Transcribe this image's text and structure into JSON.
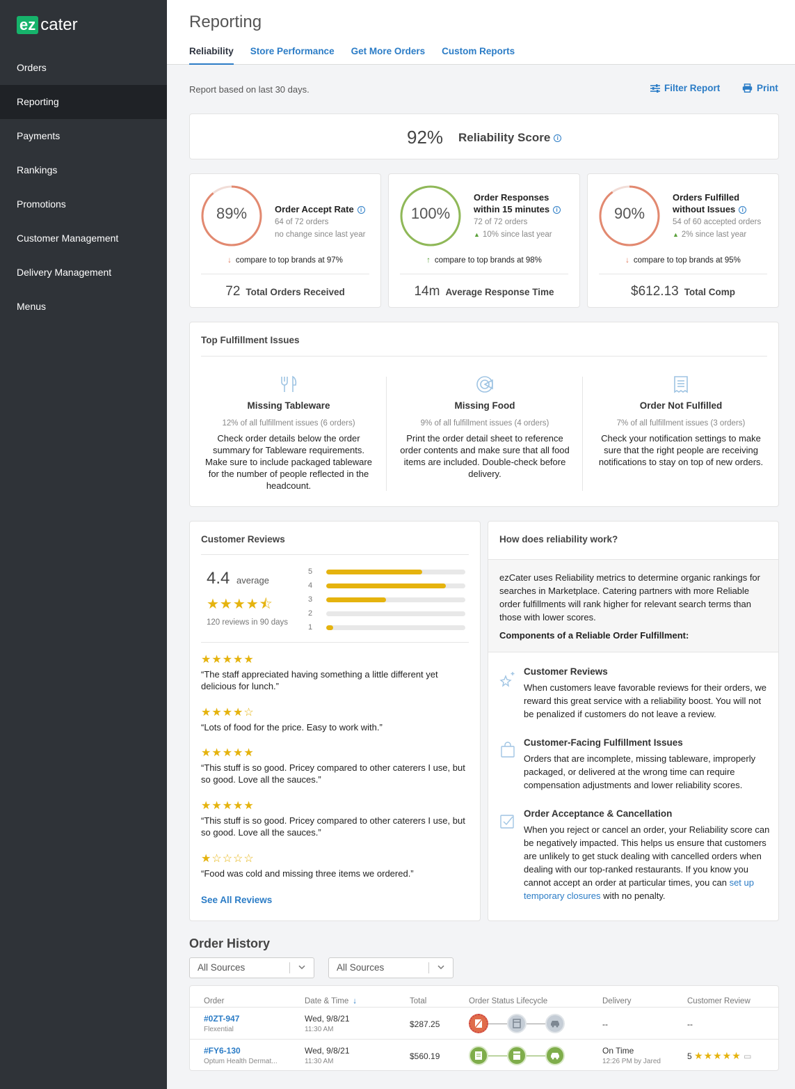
{
  "app": {
    "logo_ez": "ez",
    "logo_cater": "cater"
  },
  "nav": [
    "Orders",
    "Reporting",
    "Payments",
    "Rankings",
    "Promotions",
    "Customer Management",
    "Delivery Management",
    "Menus"
  ],
  "page": {
    "title": "Reporting",
    "tabs": [
      "Reliability",
      "Store Performance",
      "Get More Orders",
      "Custom Reports"
    ],
    "subhead": "Report based on last 30 days.",
    "filter_label": "Filter Report",
    "print_label": "Print"
  },
  "score": {
    "value": "92%",
    "label": "Reliability Score"
  },
  "metrics": [
    {
      "percent": "89%",
      "title": "Order Accept Rate",
      "sub": "64 of 72 orders",
      "trend": "no change since last year",
      "compare": "compare to top brands at 97%",
      "foot_value": "72",
      "foot_label": "Total Orders Received",
      "fraction": 0.89,
      "color": "#e28970"
    },
    {
      "percent": "100%",
      "title_line1": "Order Responses",
      "title_line2": "within 15 minutes",
      "sub": "72 of 72 orders",
      "trend": "10% since last year",
      "compare": "compare to top brands at 98%",
      "foot_value": "14m",
      "foot_label": "Average Response Time",
      "fraction": 1.0,
      "color": "#8fb858"
    },
    {
      "percent": "90%",
      "title_line1": "Orders Fulfilled",
      "title_line2": "without Issues",
      "sub": "54 of 60 accepted orders",
      "trend": "2% since last year",
      "compare": "compare to top brands at 95%",
      "foot_value": "$612.13",
      "foot_label": "Total Comp",
      "fraction": 0.9,
      "color": "#e28970"
    }
  ],
  "issues": {
    "title": "Top Fulfillment Issues",
    "items": [
      {
        "icon": "utensils-icon",
        "title": "Missing Tableware",
        "sub": "12% of all fulfillment issues (6 orders)",
        "desc": "Check order details below the order summary for Tableware requirements. Make sure to include packaged tableware for the number of people reflected in the headcount."
      },
      {
        "icon": "food-plate-icon",
        "title": "Missing Food",
        "sub": "9% of all fulfillment issues (4 orders)",
        "desc": "Print the order detail sheet to reference order contents and make sure that all food items are included. Double-check before delivery."
      },
      {
        "icon": "receipt-icon",
        "title": "Order Not Fulfilled",
        "sub": "7% of all fulfillment issues (3 orders)",
        "desc": "Check your notification settings to make sure that the right people are receiving notifications to stay on top of new orders."
      }
    ]
  },
  "reviews": {
    "title": "Customer Reviews",
    "average": "4.4",
    "average_label": "average",
    "average_stars": "★★★★⯪",
    "count": "120 reviews in 90 days",
    "distribution": [
      {
        "stars": "5",
        "fraction": 0.69
      },
      {
        "stars": "4",
        "fraction": 0.86
      },
      {
        "stars": "3",
        "fraction": 0.43
      },
      {
        "stars": "2",
        "fraction": 0.0
      },
      {
        "stars": "1",
        "fraction": 0.05
      }
    ],
    "items": [
      {
        "stars": "★★★★★",
        "text": "“The staff appreciated having something a little different yet delicious for lunch.”"
      },
      {
        "stars": "★★★★☆",
        "text": "“Lots of food for the price. Easy to work with.”"
      },
      {
        "stars": "★★★★★",
        "text": "“This stuff is so good. Pricey compared to other caterers I use, but so good. Love all the sauces.”"
      },
      {
        "stars": "★★★★★",
        "text": "“This stuff is so good. Pricey compared to other caterers I use, but so good. Love all the sauces.”"
      },
      {
        "stars": "★☆☆☆☆",
        "text": "“Food was cold and missing three items we ordered.”"
      }
    ],
    "see_all": "See All Reviews"
  },
  "how": {
    "title": "How does reliability work?",
    "intro": "ezCater uses Reliability metrics to determine organic rankings for searches in Marketplace. Catering partners with more Reliable order fulfillments will rank higher for relevant search terms than those with lower scores.",
    "components_heading": "Components of a Reliable Order Fulfillment:",
    "items": [
      {
        "icon": "sparkle-star-icon",
        "title": "Customer Reviews",
        "desc": "When customers leave favorable reviews for their orders, we reward this great service with a reliability boost. You will not be penalized if customers do not leave a review."
      },
      {
        "icon": "shopping-bag-icon",
        "title": "Customer-Facing Fulfillment Issues",
        "desc": "Orders that are incomplete, missing tableware, improperly packaged, or delivered at the wrong time can require compensation adjustments and lower reliability scores."
      },
      {
        "icon": "checkbox-icon",
        "title": "Order Acceptance & Cancellation",
        "desc_before": "When you reject or cancel an order, your Reliability score can be negatively impacted. This helps us ensure that customers are unlikely to get stuck dealing with cancelled orders when dealing with our top-ranked restaurants. If you know you cannot accept an order at particular times, you can",
        "link": "set up temporary closures",
        "desc_after": "with no penalty."
      }
    ]
  },
  "order_history": {
    "title": "Order History",
    "filters": [
      "All Sources",
      "All Sources"
    ],
    "columns": [
      "Order",
      "Date & Time",
      "Total",
      "Order Status Lifecycle",
      "Delivery",
      "Customer Review"
    ],
    "rows": [
      {
        "order": "#0ZT-947",
        "client": "Flexential",
        "date": "Wed, 9/8/21",
        "time": "11:30 AM",
        "total": "$287.25",
        "delivery": "--",
        "delivery_sub": "",
        "review": "--",
        "review_stars": ""
      },
      {
        "order": "#FY6-130",
        "client": "Optum Health Dermat...",
        "date": "Wed, 9/8/21",
        "time": "11:30 AM",
        "total": "$560.19",
        "delivery": "On Time",
        "delivery_sub": "12:26 PM by Jared",
        "review": "5",
        "review_stars": "★★★★★"
      }
    ]
  }
}
